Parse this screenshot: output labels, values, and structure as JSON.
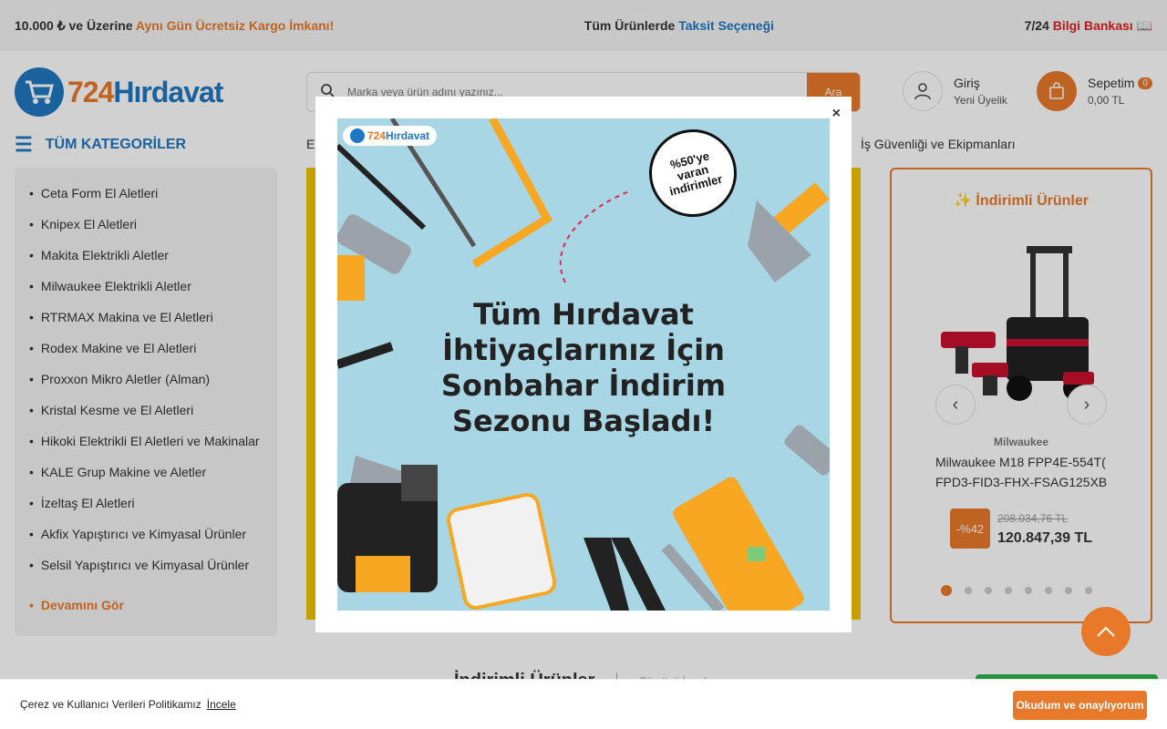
{
  "topbar": {
    "left_prefix": "10.000 ₺ ve Üzerine ",
    "left_highlight": "Aynı Gün Ücretsiz Kargo İmkanı!",
    "center_prefix": "Tüm Ürünlerde ",
    "center_highlight": "Taksit Seçeneği",
    "right_prefix": "7/24 ",
    "right_highlight": "Bilgi Bankası 📖"
  },
  "logo": {
    "number": "724",
    "name": "Hırdavat"
  },
  "search": {
    "placeholder": "Marka veya ürün adını yazınız...",
    "button": "Ara"
  },
  "account": {
    "login": "Giriş",
    "register": "Yeni Üyelik"
  },
  "cart": {
    "label": "Sepetim",
    "count": "0",
    "total": "0,00 TL"
  },
  "nav": {
    "categories_title": "TÜM KATEGORİLER",
    "first_link": "E",
    "right_link": "İş Güvenliği ve Ekipmanları"
  },
  "sidebar": {
    "items": [
      "Ceta Form El Aletleri",
      "Knipex El Aletleri",
      "Makita Elektrikli Aletler",
      "Milwaukee Elektrikli Aletler",
      "RTRMAX Makina ve El Aletleri",
      "Rodex Makine ve El Aletleri",
      "Proxxon Mikro Aletler (Alman)",
      "Kristal Kesme ve El Aletleri",
      "Hikoki Elektrikli El Aletleri ve Makinalar",
      "KALE Grup Makine ve Aletler",
      "İzeltaş El Aletleri",
      "Akfix Yapıştırıcı ve Kimyasal Ürünler",
      "Selsil Yapıştırıcı ve Kimyasal Ürünler"
    ],
    "more": "Devamını Gör"
  },
  "discount_card": {
    "title": "İndirimli Ürünler",
    "brand": "Milwaukee",
    "product_name": "Milwaukee M18 FPP4E-554T( FPD3-FID3-FHX-FSAG125XB",
    "discount": "-%42",
    "old_price": "208.034,76 TL",
    "new_price": "120.847,39 TL",
    "slide_count": 8,
    "active_slide": 1
  },
  "section": {
    "title": "İndirimli Ürünler",
    "link": "Tümünü İncele"
  },
  "modal": {
    "close": "×",
    "logo_number": "724",
    "logo_name": "Hırdavat",
    "stamp_line1": "%50'ye",
    "stamp_line2": "varan",
    "stamp_line3": "indirimler",
    "headline_line1": "Tüm Hırdavat",
    "headline_line2": "İhtiyaçlarınız İçin",
    "headline_line3": "Sonbahar İndirim",
    "headline_line4": "Sezonu Başladı!"
  },
  "cookie": {
    "text": "Çerez ve Kullanıcı Verileri Politikamız",
    "link": "İncele",
    "button": "Okudum ve onaylıyorum"
  },
  "colors": {
    "accent": "#e8792a",
    "brand_blue": "#1f78c1",
    "promo_bg": "#a9d6e5",
    "banner_yellow": "#f2c200"
  },
  "icons": [
    "search-icon",
    "user-icon",
    "bag-icon",
    "menu-icon",
    "sparkle-icon",
    "chevron-left-icon",
    "chevron-right-icon",
    "arrow-up-icon",
    "close-icon"
  ]
}
